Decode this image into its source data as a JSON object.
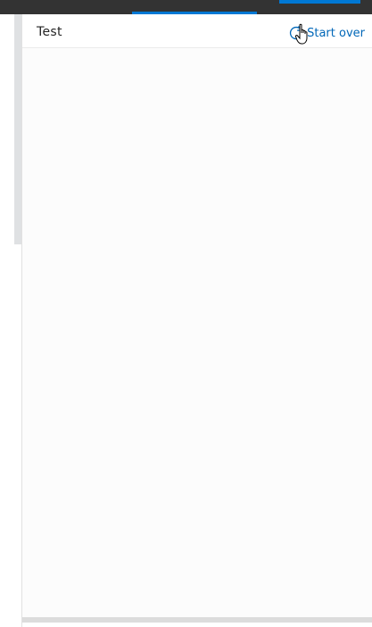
{
  "header": {
    "title": "Test",
    "start_over_label": "Start over"
  },
  "icons": {
    "refresh": "refresh-icon",
    "cursor": "hand-pointer-icon"
  },
  "colors": {
    "accent": "#0078d4",
    "link": "#0067b8",
    "topbar": "#333333"
  }
}
